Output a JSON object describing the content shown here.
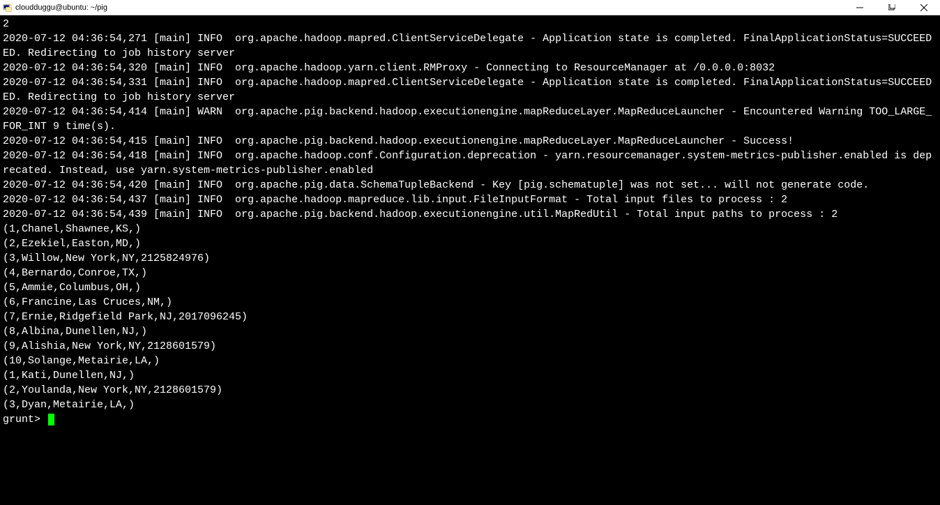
{
  "window": {
    "title": "cloudduggu@ubuntu: ~/pig"
  },
  "terminal": {
    "lines": [
      "2",
      "2020-07-12 04:36:54,271 [main] INFO  org.apache.hadoop.mapred.ClientServiceDelegate - Application state is completed. FinalApplicationStatus=SUCCEEDED. Redirecting to job history server",
      "2020-07-12 04:36:54,320 [main] INFO  org.apache.hadoop.yarn.client.RMProxy - Connecting to ResourceManager at /0.0.0.0:8032",
      "2020-07-12 04:36:54,331 [main] INFO  org.apache.hadoop.mapred.ClientServiceDelegate - Application state is completed. FinalApplicationStatus=SUCCEEDED. Redirecting to job history server",
      "2020-07-12 04:36:54,414 [main] WARN  org.apache.pig.backend.hadoop.executionengine.mapReduceLayer.MapReduceLauncher - Encountered Warning TOO_LARGE_FOR_INT 9 time(s).",
      "2020-07-12 04:36:54,415 [main] INFO  org.apache.pig.backend.hadoop.executionengine.mapReduceLayer.MapReduceLauncher - Success!",
      "2020-07-12 04:36:54,418 [main] INFO  org.apache.hadoop.conf.Configuration.deprecation - yarn.resourcemanager.system-metrics-publisher.enabled is deprecated. Instead, use yarn.system-metrics-publisher.enabled",
      "2020-07-12 04:36:54,420 [main] INFO  org.apache.pig.data.SchemaTupleBackend - Key [pig.schematuple] was not set... will not generate code.",
      "2020-07-12 04:36:54,437 [main] INFO  org.apache.hadoop.mapreduce.lib.input.FileInputFormat - Total input files to process : 2",
      "2020-07-12 04:36:54,439 [main] INFO  org.apache.pig.backend.hadoop.executionengine.util.MapRedUtil - Total input paths to process : 2",
      "(1,Chanel,Shawnee,KS,)",
      "(2,Ezekiel,Easton,MD,)",
      "(3,Willow,New York,NY,2125824976)",
      "(4,Bernardo,Conroe,TX,)",
      "(5,Ammie,Columbus,OH,)",
      "(6,Francine,Las Cruces,NM,)",
      "(7,Ernie,Ridgefield Park,NJ,2017096245)",
      "(8,Albina,Dunellen,NJ,)",
      "(9,Alishia,New York,NY,2128601579)",
      "(10,Solange,Metairie,LA,)",
      "(1,Kati,Dunellen,NJ,)",
      "(2,Youlanda,New York,NY,2128601579)",
      "(3,Dyan,Metairie,LA,)"
    ],
    "prompt": "grunt> "
  }
}
